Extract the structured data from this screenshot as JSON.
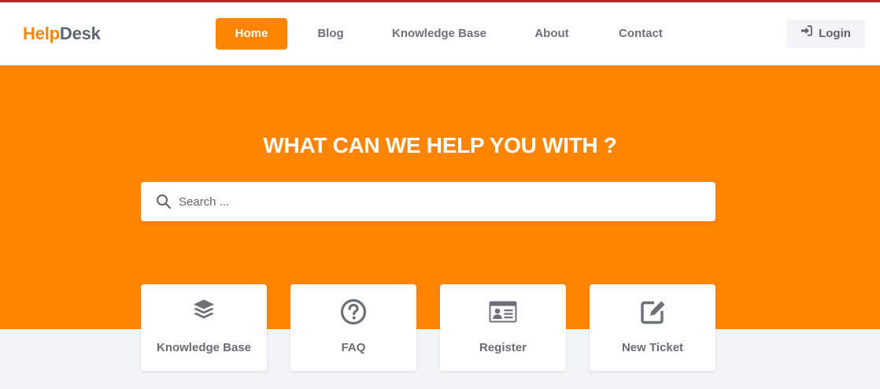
{
  "brand": {
    "part1": "Help",
    "part2": "Desk",
    "accent": "#ff8500",
    "top_line": "#b32b1e"
  },
  "nav": {
    "items": [
      {
        "label": "Home",
        "active": true
      },
      {
        "label": "Blog",
        "active": false
      },
      {
        "label": "Knowledge Base",
        "active": false
      },
      {
        "label": "About",
        "active": false
      },
      {
        "label": "Contact",
        "active": false
      }
    ],
    "login": {
      "label": "Login",
      "icon": "sign-in-icon"
    }
  },
  "hero": {
    "title": "WHAT CAN WE HELP YOU WITH ?",
    "search": {
      "placeholder": "Search ...",
      "value": "",
      "icon": "search-icon"
    },
    "background": "#ff8500"
  },
  "cards": [
    {
      "label": "Knowledge Base",
      "icon": "layers-icon"
    },
    {
      "label": "FAQ",
      "icon": "question-circle-icon"
    },
    {
      "label": "Register",
      "icon": "id-card-icon"
    },
    {
      "label": "New Ticket",
      "icon": "edit-icon"
    }
  ]
}
